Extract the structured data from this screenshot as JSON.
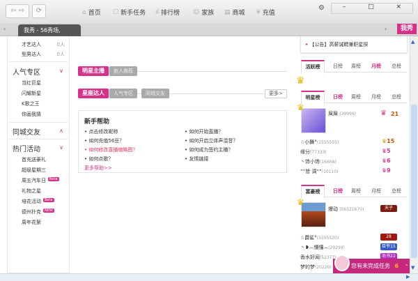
{
  "browser": {
    "tab_title": "我秀 - 56秀场,",
    "logo": "我秀",
    "nav": [
      {
        "icon": "home-icon",
        "glyph": "⌂",
        "label": "首页"
      },
      {
        "icon": "task-icon",
        "glyph": "☐",
        "label": "新手任务"
      },
      {
        "icon": "chart-icon",
        "glyph": "ıl",
        "label": "排行榜"
      },
      {
        "icon": "family-icon",
        "glyph": "☺",
        "label": "家族"
      },
      {
        "icon": "shop-icon",
        "glyph": "▤",
        "label": "商城"
      },
      {
        "icon": "recharge-icon",
        "glyph": "¥",
        "label": "充值"
      }
    ]
  },
  "sidebar": {
    "top_items": [
      {
        "label": "才艺达人",
        "count": "0人"
      },
      {
        "label": "型男达人",
        "count": "0人"
      }
    ],
    "popular": {
      "title": "人气专区",
      "items": [
        "当红巨星",
        "闪耀新星",
        "K歌之王",
        "你画我猜"
      ]
    },
    "city": {
      "title": "同城交友"
    },
    "events": {
      "title": "热门活动",
      "items": [
        {
          "label": "首充送豪礼",
          "badge": ""
        },
        {
          "label": "超级星期三",
          "badge": ""
        },
        {
          "label": "周五汽车日",
          "badge": "Beta"
        },
        {
          "label": "礼物之星",
          "badge": ""
        },
        {
          "label": "培花活动",
          "badge": "Beta"
        },
        {
          "label": "德州扑克",
          "badge": "NEW"
        },
        {
          "label": "周年花絮",
          "badge": ""
        }
      ]
    }
  },
  "main": {
    "row1_tabs": [
      "明星主播",
      "新人推荐"
    ],
    "row2_tabs": [
      "星座达人",
      "人气专区",
      "同城交友"
    ],
    "more": "更多>",
    "help": {
      "title": "新手帮助",
      "left": [
        "点击修改昵称",
        "如何充值56豆？",
        "如何修改直播缩略图？",
        "如何点歌？"
      ],
      "right": [
        "如何开始直播？",
        "如何开启立体声混音？",
        "如何成为签约主播？",
        "友情链接"
      ],
      "more": "更多帮助>>"
    }
  },
  "right": {
    "notice": "【公告】高薪诚聘兼职星探",
    "active": {
      "title": "活跃榜",
      "tabs": [
        "日榜",
        "周榜",
        "月榜",
        "总榜"
      ],
      "selected": 2
    },
    "star": {
      "title": "明星榜",
      "tabs": [
        "日榜",
        "周榜",
        "月榜",
        "总榜"
      ],
      "selected": 0,
      "top": {
        "name": "屎屎",
        "score": "(39999)",
        "level": "21"
      },
      "rows": [
        {
          "name": "☆小舞°",
          "score": "(1555555)",
          "level": "15"
        },
        {
          "name": "缘分",
          "score": "(77333)",
          "level": "5"
        },
        {
          "name": "丶馋小馋",
          "score": "(16668)",
          "level": "6"
        },
        {
          "name": "“”皆 调“”",
          "score": "(10110)",
          "level": "9"
        }
      ]
    },
    "rich": {
      "title": "富豪榜",
      "tabs": [
        "日榜",
        "周榜",
        "月榜",
        "总榜"
      ],
      "selected": 0,
      "top": {
        "name": "爆动",
        "score": "(56521670)",
        "badge": "天子"
      },
      "rows": [
        {
          "name": "☆爵鲨°",
          "score": "(5555520)",
          "badge": "28"
        },
        {
          "name": "丶❥෴懵懂෴",
          "score": "(29299)",
          "badge": "臣爷15"
        },
        {
          "name": "香水好闻",
          "score": "(52377)",
          "badge": "尚书22"
        },
        {
          "name": "梦的梦",
          "score": "(20220)",
          "badge": ""
        }
      ]
    }
  },
  "task_popup": {
    "text": "您有未完成任务",
    "count": "6"
  },
  "colors": {
    "accent": "#d6328a",
    "link_red": "#e8335b"
  }
}
